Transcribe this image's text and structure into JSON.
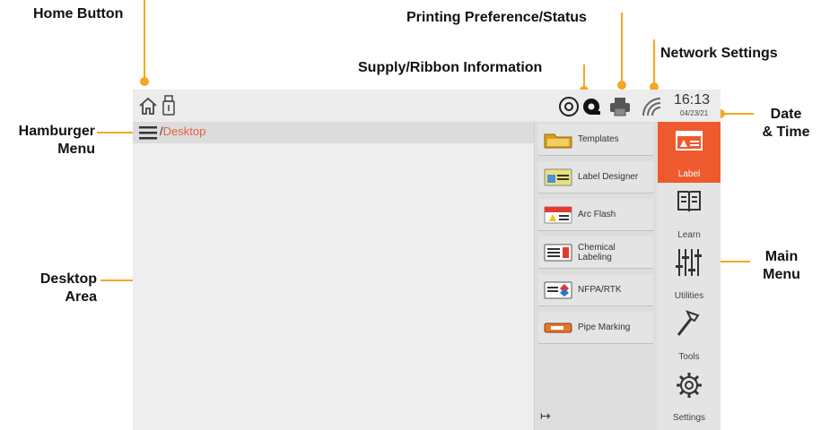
{
  "callouts": {
    "home": "Home Button",
    "printing": "Printing Preference/Status",
    "network": "Network Settings",
    "supply": "Supply/Ribbon Information",
    "hamburger_1": "Hamburger",
    "hamburger_2": "Menu",
    "date_1": "Date",
    "date_2": "& Time",
    "desktop_1": "Desktop",
    "desktop_2": "Area",
    "mainmenu_1": "Main",
    "mainmenu_2": "Menu"
  },
  "status": {
    "time": "16:13",
    "date": "04/23/21"
  },
  "breadcrumb": {
    "separator": "/",
    "current": "Desktop"
  },
  "panel": {
    "items": [
      {
        "label": "Templates",
        "icon": "folder-icon"
      },
      {
        "label": "Label Designer",
        "icon": "label-designer-icon"
      },
      {
        "label": "Arc Flash",
        "icon": "arc-flash-icon"
      },
      {
        "label": "Chemical Labeling",
        "icon": "chemical-label-icon"
      },
      {
        "label": "NFPA/RTK",
        "icon": "nfpa-icon"
      },
      {
        "label": "Pipe Marking",
        "icon": "pipe-marker-icon"
      }
    ]
  },
  "main_menu": {
    "items": [
      {
        "label": "Label",
        "icon": "label-icon",
        "active": true
      },
      {
        "label": "Learn",
        "icon": "book-icon"
      },
      {
        "label": "Utilities",
        "icon": "sliders-icon"
      },
      {
        "label": "Tools",
        "icon": "hammer-icon"
      },
      {
        "label": "Settings",
        "icon": "gear-icon"
      }
    ]
  },
  "colors": {
    "accent": "#ee5a2e",
    "callout_line": "#f5a623"
  }
}
